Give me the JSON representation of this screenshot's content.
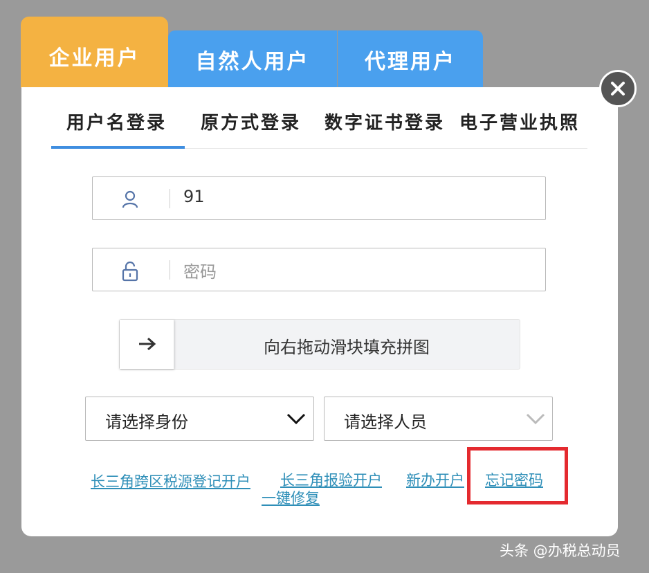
{
  "user_type_tabs": [
    "企业用户",
    "自然人用户",
    "代理用户"
  ],
  "login_tabs": [
    "用户名登录",
    "原方式登录",
    "数字证书登录",
    "电子营业执照"
  ],
  "username": {
    "value": "91",
    "icon": "user-icon"
  },
  "password": {
    "placeholder": "密码",
    "icon": "lock-icon"
  },
  "slider": {
    "label": "向右拖动滑块填充拼图",
    "icon": "arrow-right-icon"
  },
  "identity_select": {
    "label": "请选择身份"
  },
  "person_select": {
    "label": "请选择人员"
  },
  "links": [
    "长三角跨区税源登记开户",
    "长三角报验开户",
    "新办开户",
    "忘记密码",
    "一键修复"
  ],
  "close": {
    "icon": "close-icon"
  },
  "watermark": "头条 @办税总动员",
  "colors": {
    "active_tab": "#f4b242",
    "tab": "#4aa0ee",
    "link": "#2f8fb8",
    "highlight": "#e42a2f"
  }
}
